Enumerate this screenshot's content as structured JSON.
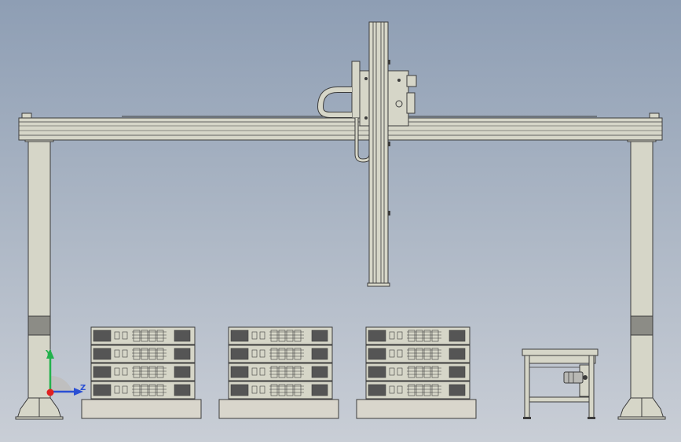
{
  "view": {
    "background_top": "#8e9eb4",
    "background_bottom": "#c9ced6"
  },
  "model": {
    "metal_color": "#d6d6c8",
    "edge_color": "#3c3c3c",
    "band_color": "#8c8c86",
    "pallet_color": "#d9d6cc",
    "motor_color": "#b8b8b4"
  },
  "triad": {
    "y_label": "Y",
    "z_label": "Z",
    "y_color": "#22b14c",
    "z_color": "#2a4fd4",
    "x_color": "#e02020"
  },
  "stacks": {
    "count": 3,
    "rows_per_stack": 4
  }
}
